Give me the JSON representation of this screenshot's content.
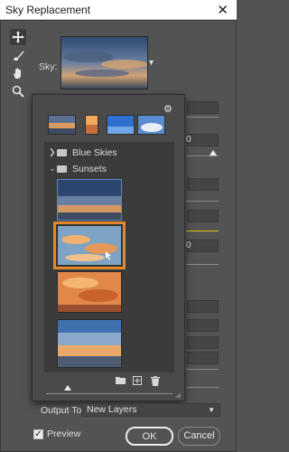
{
  "window": {
    "title": "Sky Replacement",
    "close_glyph": "✕"
  },
  "tools": [
    "move-sky-tool",
    "sky-brush-tool",
    "hand-tool",
    "zoom-tool"
  ],
  "sky": {
    "label": "Sky:"
  },
  "partial_values": [
    {
      "text": "0"
    },
    {
      "text": "0"
    }
  ],
  "panel": {
    "folders": [
      {
        "label": "Blue Skies",
        "expanded": false
      },
      {
        "label": "Sunsets",
        "expanded": true
      }
    ]
  },
  "output": {
    "label": "Output To:",
    "value": "New Layers"
  },
  "preview": {
    "label": "Preview",
    "checked": true
  },
  "buttons": {
    "ok": "OK",
    "cancel": "Cancel"
  }
}
